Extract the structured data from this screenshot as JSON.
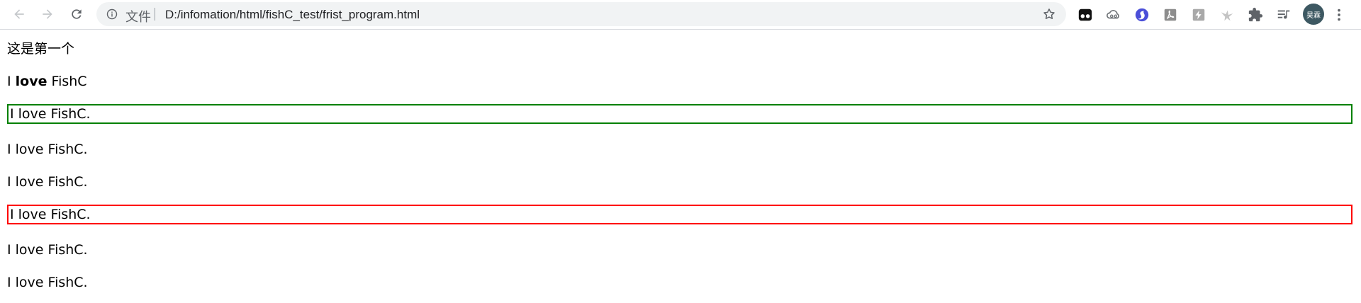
{
  "browser": {
    "omnibox": {
      "security_label": "文件",
      "url": "D:/infomation/html/fishC_test/frist_program.html"
    },
    "nav_icons": [
      "back-arrow-icon",
      "forward-arrow-icon",
      "reload-icon"
    ],
    "extensions": [
      "tampermonkey-icon",
      "cloud-sync-icon",
      "blue-swirl-icon",
      "pdf-icon",
      "lightning-icon",
      "bird-icon",
      "puzzle-icon",
      "reading-list-icon"
    ],
    "profile": {
      "avatar_text": "昊霖",
      "avatar_color": "#3d5862"
    }
  },
  "page": {
    "line1": "这是第一个",
    "line2": {
      "prefix": "I ",
      "bold": "love",
      "suffix": " FishC"
    },
    "paragraphs": [
      {
        "text": "I love FishC.",
        "border": "#008000"
      },
      {
        "text": "I love FishC."
      },
      {
        "text": "I love FishC."
      },
      {
        "text": "I love FishC.",
        "border": "#ff0000"
      },
      {
        "text": "I love FishC."
      },
      {
        "text": "I love FishC."
      }
    ]
  }
}
